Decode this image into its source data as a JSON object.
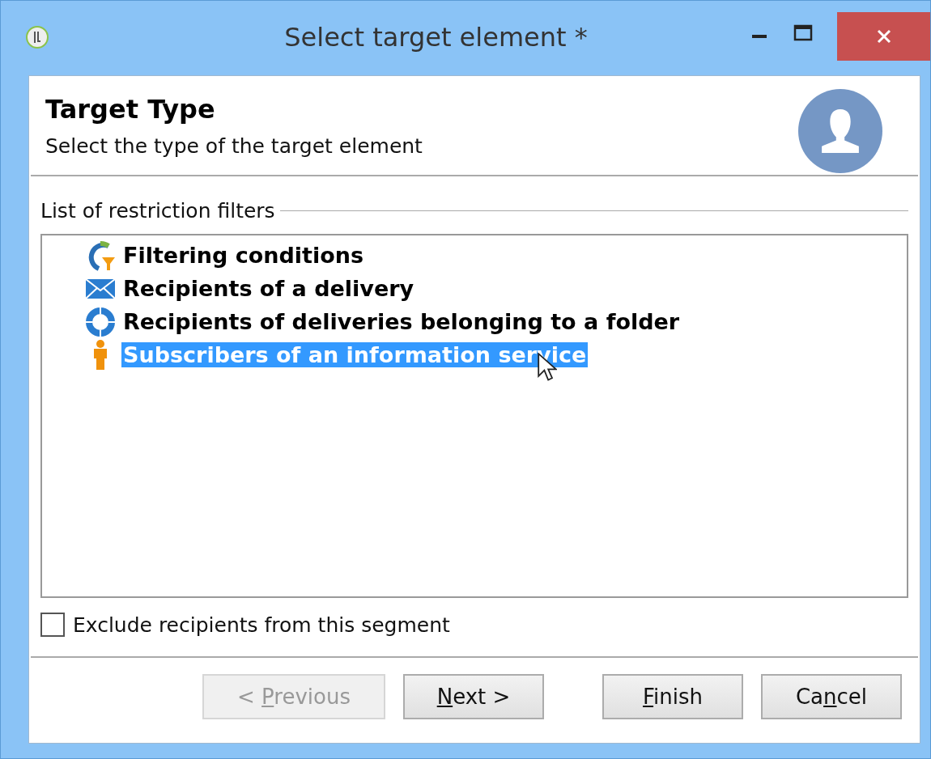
{
  "window": {
    "title": "Select target element *"
  },
  "header": {
    "title": "Target Type",
    "subtitle": "Select the type of the target element"
  },
  "group": {
    "label": "List of restriction filters"
  },
  "filters": [
    {
      "label": "Filtering conditions",
      "kind": "filter",
      "selected": false
    },
    {
      "label": "Recipients of a delivery",
      "kind": "envelope",
      "selected": false
    },
    {
      "label": "Recipients of deliveries belonging to a folder",
      "kind": "ring",
      "selected": false
    },
    {
      "label": "Subscribers of an information service",
      "kind": "person",
      "selected": true
    }
  ],
  "exclude": {
    "label": "Exclude recipients from this segment",
    "checked": false
  },
  "buttons": [
    {
      "before": "< ",
      "key": "P",
      "after": "revious",
      "disabled": true
    },
    {
      "key": "N",
      "after": "ext >",
      "disabled": false
    },
    {
      "key": "F",
      "after": "inish",
      "disabled": false
    },
    {
      "before": "Ca",
      "key": "n",
      "after": "cel",
      "disabled": false
    }
  ]
}
